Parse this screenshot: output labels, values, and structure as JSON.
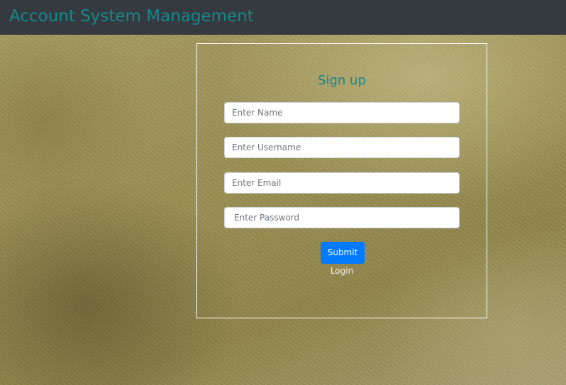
{
  "navbar": {
    "brand": "Account System Management"
  },
  "form": {
    "title": "Sign up",
    "fields": {
      "name": {
        "placeholder": "Enter Name",
        "value": ""
      },
      "username": {
        "placeholder": "Enter Username",
        "value": ""
      },
      "email": {
        "placeholder": "Enter Email",
        "value": ""
      },
      "password": {
        "placeholder": "Enter Password",
        "value": ""
      }
    },
    "submit_label": "Submit",
    "login_link": "Login"
  },
  "colors": {
    "navbar_bg": "#343a40",
    "brand_text": "#17878a",
    "title_text": "#17878a",
    "submit_bg": "#007bff",
    "form_border": "#ffffff"
  }
}
